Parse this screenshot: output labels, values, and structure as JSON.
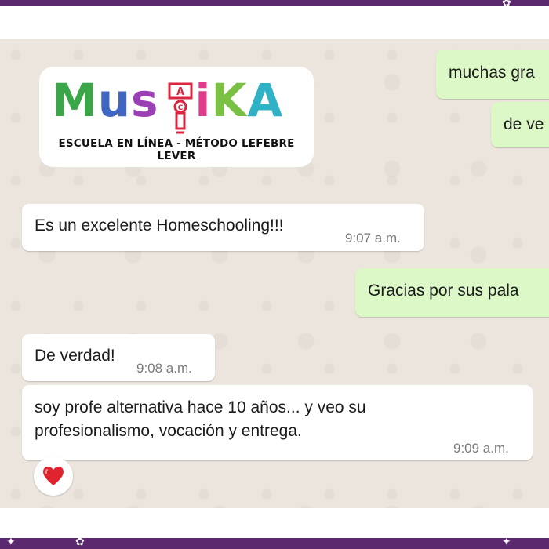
{
  "logo": {
    "letters": [
      "M",
      "u",
      "s",
      "i",
      "K",
      "A"
    ],
    "figure_letters": [
      "A",
      "C"
    ],
    "subtitle": "ESCUELA EN LÍNEA - MÉTODO LEFEBRE LEVER"
  },
  "messages": [
    {
      "direction": "outgoing",
      "text": "muchas gra",
      "time": ""
    },
    {
      "direction": "outgoing",
      "text": "de ve",
      "time": ""
    },
    {
      "direction": "incoming",
      "text": "Es un excelente Homeschooling!!!",
      "time": "9:07 a.m."
    },
    {
      "direction": "outgoing",
      "text": "Gracias por sus pala",
      "time": ""
    },
    {
      "direction": "incoming",
      "text": "De verdad!",
      "time": "9:08 a.m."
    },
    {
      "direction": "incoming",
      "text_lines": [
        "soy profe alternativa hace 10 años... y veo su",
        "profesionalismo, vocación y entrega."
      ],
      "time": "9:09 a.m."
    }
  ],
  "reaction": {
    "icon": "heart-icon",
    "color": "#e0242f"
  },
  "colors": {
    "chat_background": "#ece5dd",
    "incoming_bubble": "#ffffff",
    "outgoing_bubble": "#dcf8c6",
    "frame": "#5b2a6e"
  }
}
